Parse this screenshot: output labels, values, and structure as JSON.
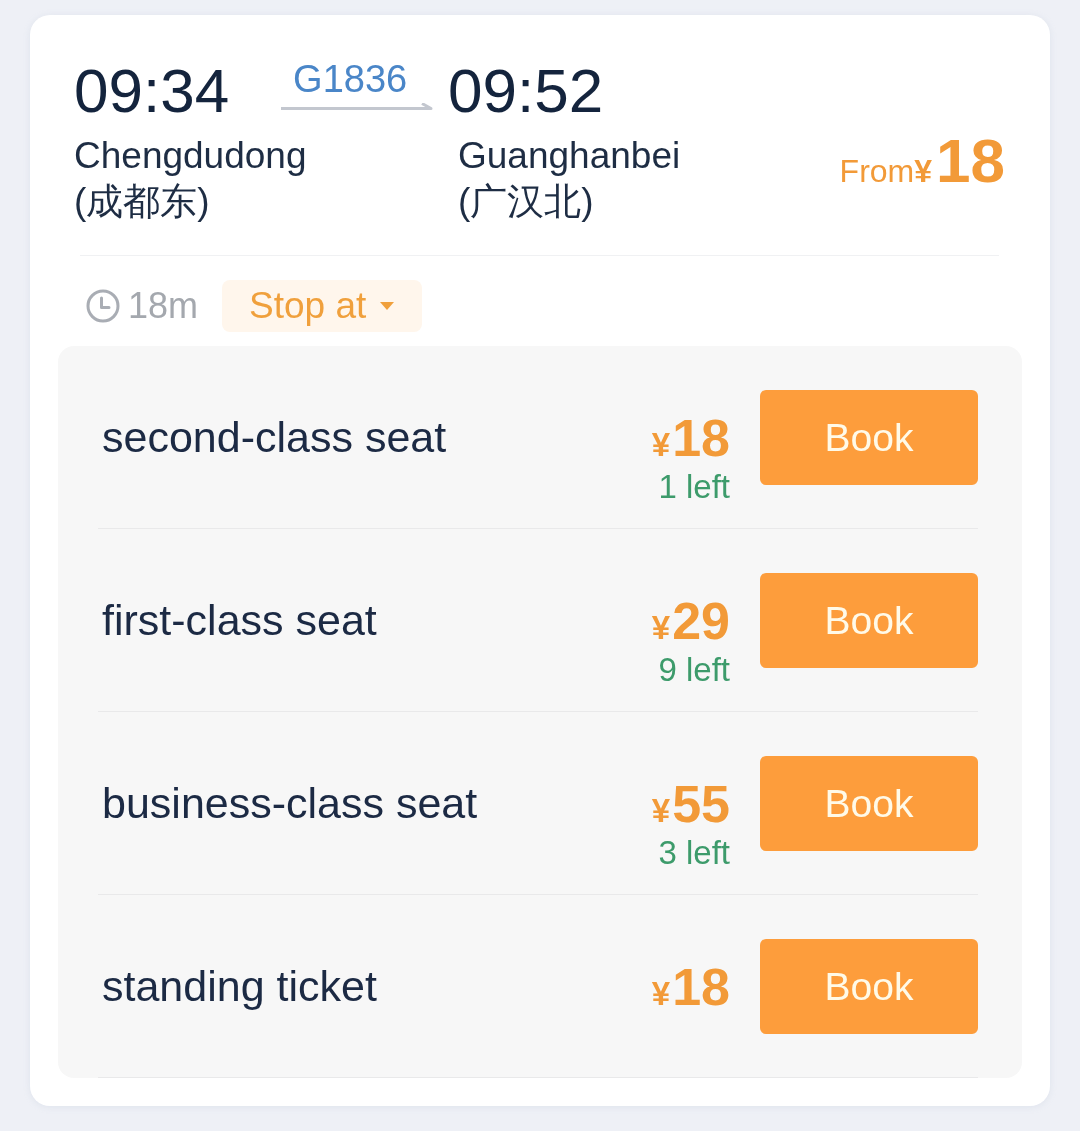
{
  "departure": {
    "time": "09:34",
    "station": "Chengdudong",
    "station_local": "(成都东)"
  },
  "train_number": "G1836",
  "arrival": {
    "time": "09:52",
    "station": "Guanghanbei",
    "station_local": "(广汉北)"
  },
  "lowest_price": {
    "prefix": "From",
    "currency": "¥",
    "amount": "18"
  },
  "duration": "18m",
  "stops_button": {
    "label": "Stop at"
  },
  "seats": [
    {
      "name": "second-class seat",
      "currency": "¥",
      "price": "18",
      "availability": "1 left",
      "button": "Book"
    },
    {
      "name": "first-class seat",
      "currency": "¥",
      "price": "29",
      "availability": "9 left",
      "button": "Book"
    },
    {
      "name": "business-class seat",
      "currency": "¥",
      "price": "55",
      "availability": "3 left",
      "button": "Book"
    },
    {
      "name": "standing ticket",
      "currency": "¥",
      "price": "18",
      "button": "Book"
    }
  ]
}
